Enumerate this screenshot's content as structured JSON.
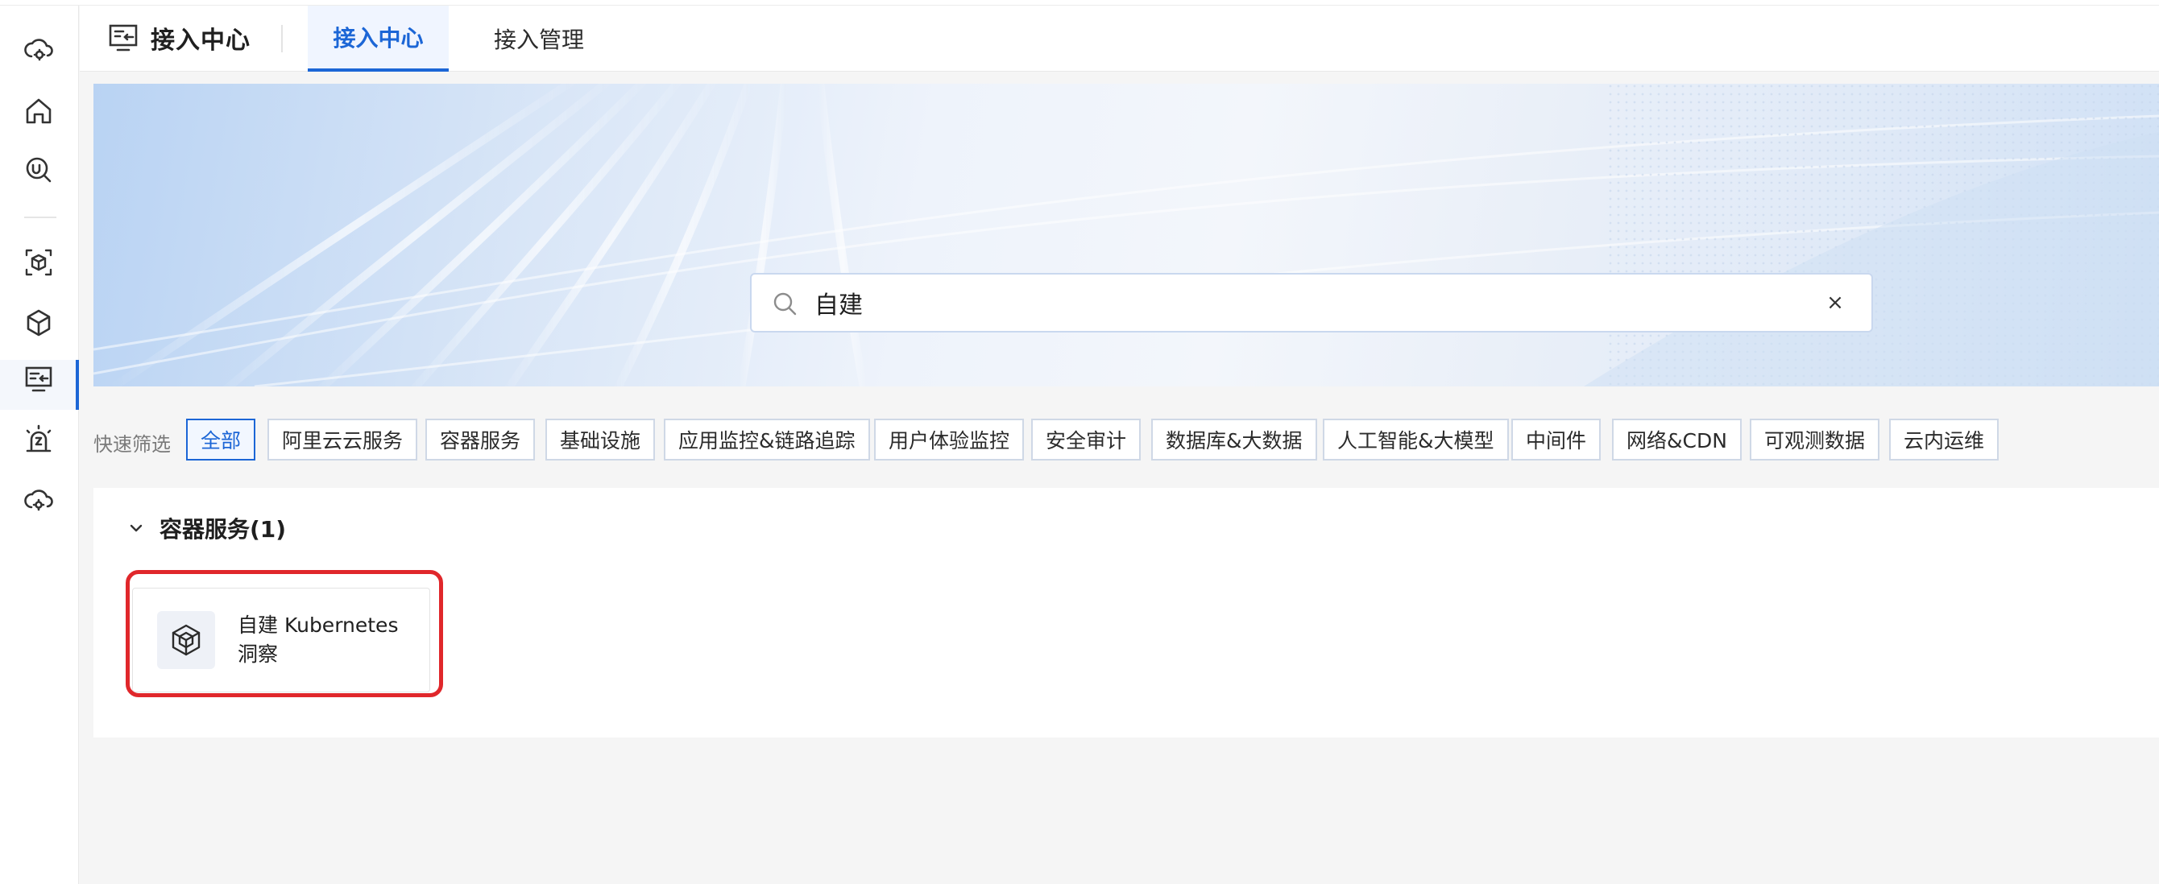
{
  "header": {
    "app_title": "接入中心",
    "tabs": [
      {
        "label": "接入中心",
        "active": true
      },
      {
        "label": "接入管理",
        "active": false
      }
    ]
  },
  "sidebar": {
    "items": [
      {
        "icon": "cloud-gear-icon"
      },
      {
        "icon": "home-icon"
      },
      {
        "icon": "search-magnifier-icon"
      },
      {
        "icon": "cube-frame-icon"
      },
      {
        "icon": "cube-icon"
      },
      {
        "icon": "integration-monitor-icon",
        "active": true
      },
      {
        "icon": "alert-bulb-icon"
      },
      {
        "icon": "cloud-settings-icon"
      }
    ]
  },
  "search": {
    "value": "自建",
    "clear_label": "×"
  },
  "filters": {
    "label": "快速筛选",
    "chips": [
      {
        "label": "全部",
        "active": true
      },
      {
        "label": "阿里云云服务"
      },
      {
        "label": "容器服务"
      },
      {
        "label": "基础设施"
      },
      {
        "label": "应用监控&链路追踪"
      },
      {
        "label": "用户体验监控"
      },
      {
        "label": "安全审计"
      },
      {
        "label": "数据库&大数据"
      },
      {
        "label": "人工智能&大模型"
      },
      {
        "label": "中间件"
      },
      {
        "label": "网络&CDN"
      },
      {
        "label": "可观测数据"
      },
      {
        "label": "云内运维"
      }
    ]
  },
  "results": {
    "section_title": "容器服务(1)",
    "cards": [
      {
        "name": "自建 Kubernetes 洞察",
        "icon": "kubernetes-cube-icon"
      }
    ]
  },
  "colors": {
    "accent": "#1c66d6",
    "highlight": "#e0272b"
  }
}
